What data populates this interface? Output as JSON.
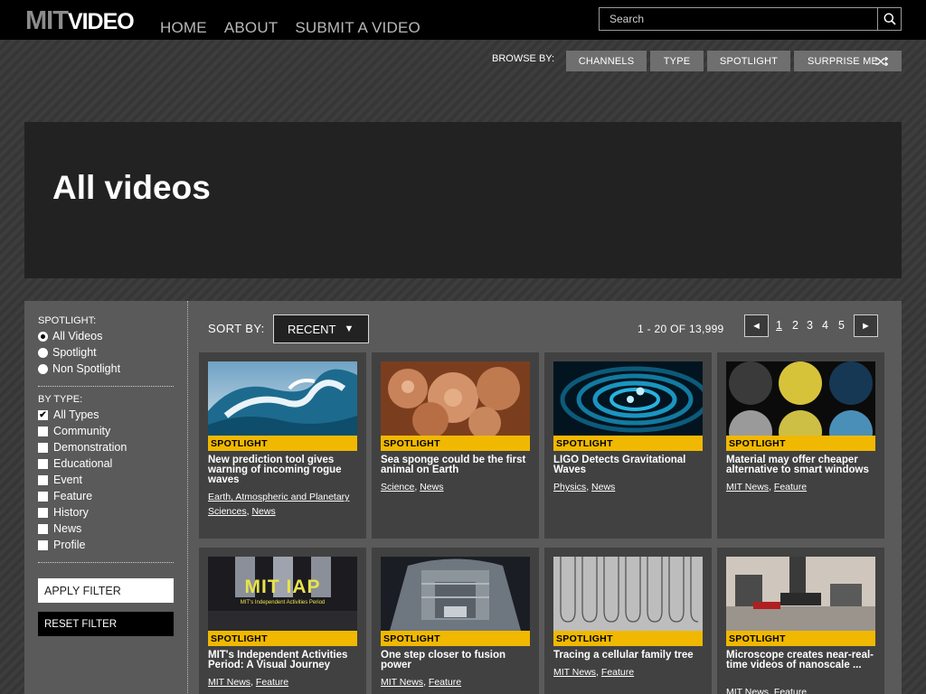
{
  "header": {
    "logo_mit": "MIT",
    "logo_video": "VIDEO",
    "nav": [
      "HOME",
      "ABOUT",
      "SUBMIT A VIDEO"
    ],
    "search_placeholder": "Search"
  },
  "browse": {
    "label": "BROWSE BY:",
    "buttons": [
      "CHANNELS",
      "TYPE",
      "SPOTLIGHT",
      "SURPRISE ME"
    ]
  },
  "hero": {
    "title": "All videos"
  },
  "sidebar": {
    "spotlight_title": "SPOTLIGHT:",
    "spotlight_options": [
      "All Videos",
      "Spotlight",
      "Non Spotlight"
    ],
    "type_title": "BY TYPE:",
    "type_options": [
      "All Types",
      "Community",
      "Demonstration",
      "Educational",
      "Event",
      "Feature",
      "History",
      "News",
      "Profile"
    ],
    "apply_label": "APPLY FILTER",
    "reset_label": "RESET FILTER"
  },
  "sort": {
    "label": "SORT BY:",
    "value": "RECENT"
  },
  "pagination": {
    "range": "1 - 20 OF 13,999",
    "pages": [
      "1",
      "2",
      "3",
      "4",
      "5"
    ],
    "prev": "◄",
    "next": "►"
  },
  "cards": [
    {
      "badge": "SPOTLIGHT",
      "title": "New prediction tool gives warning of incoming rogue waves",
      "tags": [
        "Earth, Atmospheric and Planetary Sciences",
        "News"
      ]
    },
    {
      "badge": "SPOTLIGHT",
      "title": "Sea sponge could be the first animal on Earth",
      "tags": [
        "Science",
        "News"
      ]
    },
    {
      "badge": "SPOTLIGHT",
      "title": "LIGO Detects Gravitational Waves",
      "tags": [
        "Physics",
        "News"
      ]
    },
    {
      "badge": "SPOTLIGHT",
      "title": "Material may offer cheaper alternative to smart windows",
      "tags": [
        "MIT News",
        "Feature"
      ]
    },
    {
      "badge": "SPOTLIGHT",
      "title": "MIT's Independent Activities Period: A Visual Journey",
      "tags": [
        "MIT News",
        "Feature"
      ]
    },
    {
      "badge": "SPOTLIGHT",
      "title": "One step closer to fusion power",
      "tags": [
        "MIT News",
        "Feature"
      ]
    },
    {
      "badge": "SPOTLIGHT",
      "title": "Tracing a cellular family tree",
      "tags": [
        "MIT News",
        "Feature"
      ]
    },
    {
      "badge": "SPOTLIGHT",
      "title": "Microscope creates near-real-time videos of nanoscale ...",
      "tags": [
        "MIT News",
        "Feature"
      ]
    }
  ],
  "thumb_text": {
    "iap_big": "MIT IAP",
    "iap_small": "MIT's Independent Activities Period"
  }
}
